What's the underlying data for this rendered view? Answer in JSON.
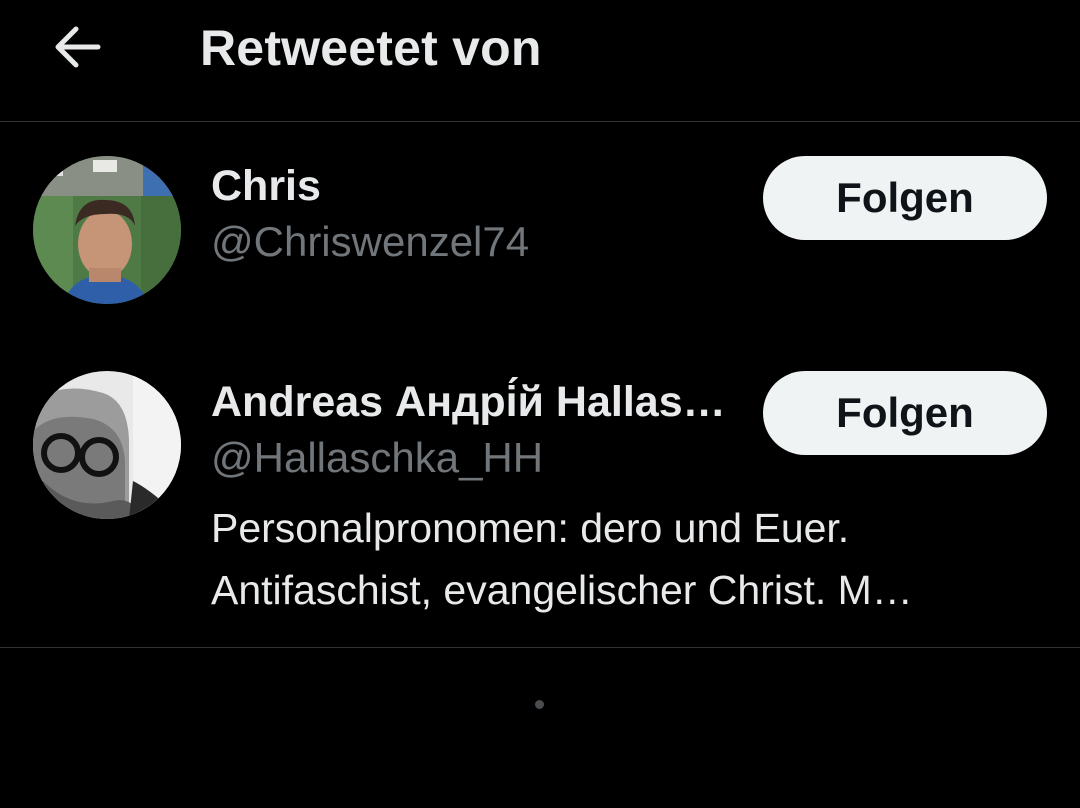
{
  "header": {
    "back_icon": "arrow-left-icon",
    "title": "Retweetet von"
  },
  "users": [
    {
      "display_name": "Chris",
      "handle": "@Chriswenzel74",
      "follow_label": "Folgen",
      "bio_lines": []
    },
    {
      "display_name": "Andreas Андрі́й Hallas…",
      "handle": "@Hallaschka_HH",
      "follow_label": "Folgen",
      "bio_lines": [
        "Personalpronomen: dero und Euer.",
        "Antifaschist, evangelischer Christ. M…"
      ]
    }
  ],
  "colors": {
    "background": "#000000",
    "text_primary": "#e7e9ea",
    "text_secondary": "#71767b",
    "divider": "#2f3336",
    "button_bg": "#eff3f4",
    "button_text": "#0f1419"
  }
}
